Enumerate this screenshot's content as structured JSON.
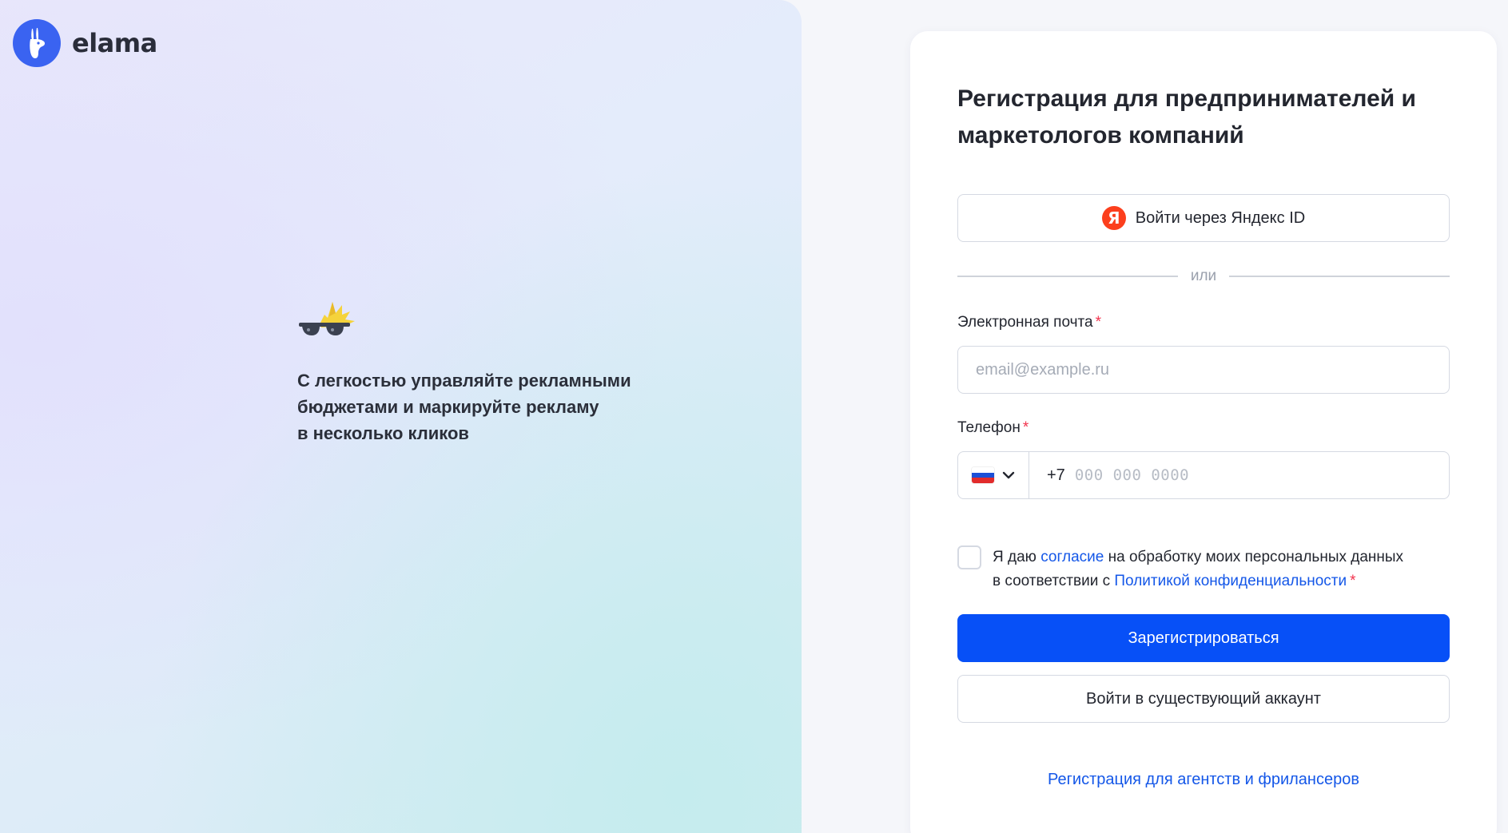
{
  "brand": {
    "name": "elama",
    "logo_color": "#3a63f1"
  },
  "promo": {
    "illustration_icon": "sunglasses-spiky-hair-icon",
    "text": "С легкостью управляйте рекламными\nбюджетами и маркируйте рекламу\nв несколько кликов"
  },
  "form": {
    "title": "Регистрация для предпринимателей и\nмаркетологов компаний",
    "yandex_button": {
      "icon": "yandex-icon",
      "icon_letter": "Я",
      "label": "Войти через Яндекс ID"
    },
    "divider_text": "или",
    "email": {
      "label": "Электронная почта",
      "required_mark": "*",
      "placeholder": "email@example.ru",
      "value": ""
    },
    "phone": {
      "label": "Телефон",
      "required_mark": "*",
      "country": "Russia",
      "country_flag_icon": "russia-flag-icon",
      "dropdown_icon": "chevron-down-icon",
      "prefix": "+7",
      "placeholder": "000 000 0000"
    },
    "consent": {
      "checked": false,
      "text_before": "Я даю ",
      "link1": "согласие",
      "text_middle": " на обработку моих персональных данных",
      "text_line2": "в соответствии с ",
      "link2": "Политикой конфиденциальности",
      "required_mark": "*"
    },
    "register_button": "Зарегистрироваться",
    "login_button": "Войти в существующий аккаунт",
    "agency_link": "Регистрация для агентств и фрилансеров"
  },
  "colors": {
    "primary": "#0750f7",
    "link": "#1457e8",
    "required": "#f2334d",
    "yandex": "#fc3f1d"
  }
}
